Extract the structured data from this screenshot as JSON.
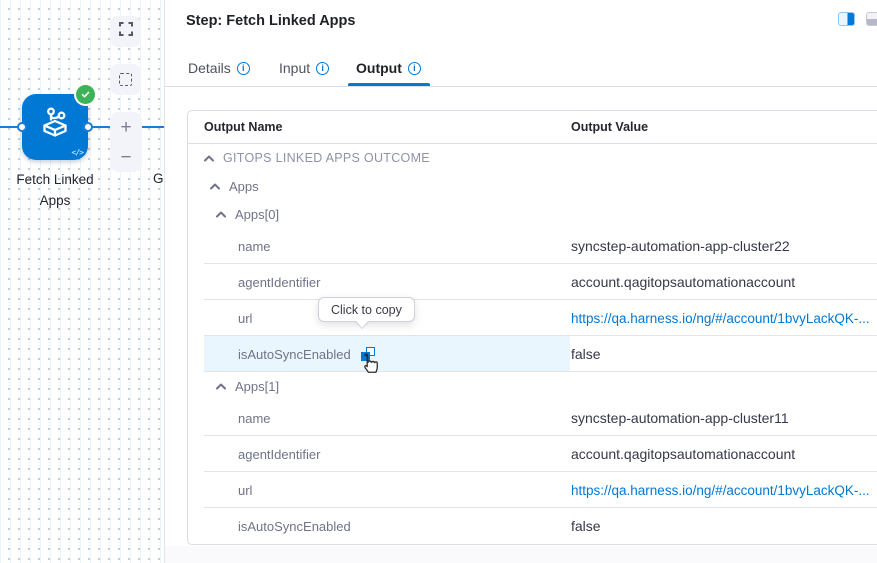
{
  "canvas": {
    "node_label": "Fetch Linked Apps",
    "node_status": "success",
    "next_node_label": "G",
    "node_code_glyph": "</>",
    "zoom_in": "+",
    "zoom_out": "−"
  },
  "panel": {
    "title": "Step: Fetch Linked Apps",
    "info_icon_glyph": "i",
    "tabs": [
      {
        "label": "Details",
        "active": false
      },
      {
        "label": "Input",
        "active": false
      },
      {
        "label": "Output",
        "active": true
      }
    ],
    "tooltip": "Click to copy",
    "table": {
      "col_name": "Output Name",
      "col_value": "Output Value",
      "rows": [
        {
          "type": "group",
          "level": 0,
          "label": "GITOPS LINKED APPS OUTCOME"
        },
        {
          "type": "group",
          "level": 1,
          "label": "Apps"
        },
        {
          "type": "group",
          "level": 2,
          "label": "Apps[0]"
        },
        {
          "type": "leaf",
          "label": "name",
          "value": "syncstep-automation-app-cluster22"
        },
        {
          "type": "leaf",
          "label": "agentIdentifier",
          "value": "account.qagitopsautomationaccount"
        },
        {
          "type": "leaf",
          "label": "url",
          "value": "https://qa.harness.io/ng/#/account/1bvyLackQK-...",
          "link": true
        },
        {
          "type": "leaf",
          "label": "isAutoSyncEnabled",
          "value": "false",
          "highlighted": true
        },
        {
          "type": "group",
          "level": 2,
          "label": "Apps[1]"
        },
        {
          "type": "leaf",
          "label": "name",
          "value": "syncstep-automation-app-cluster11"
        },
        {
          "type": "leaf",
          "label": "agentIdentifier",
          "value": "account.qagitopsautomationaccount"
        },
        {
          "type": "leaf",
          "label": "url",
          "value": "https://qa.harness.io/ng/#/account/1bvyLackQK-...",
          "link": true
        },
        {
          "type": "leaf",
          "label": "isAutoSyncEnabled",
          "value": "false"
        }
      ]
    }
  },
  "colors": {
    "accent": "#0278d5",
    "success": "#3cb356",
    "link": "#0278d5",
    "row_highlight": "#e9f6fd"
  }
}
